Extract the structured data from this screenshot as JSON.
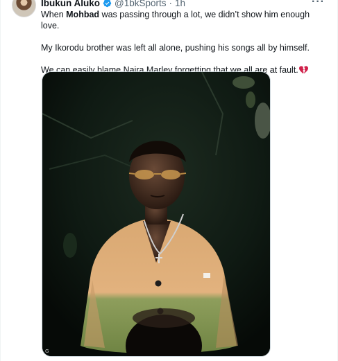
{
  "tweet": {
    "author_name": "Ibukun Aluko",
    "handle": "@1bkSports",
    "separator": "·",
    "time": "1h",
    "more_label": "···",
    "paragraph1": {
      "before": "When ",
      "mention": "Mohbad",
      "after": " was passing through a lot, we didn’t show him enough love."
    },
    "paragraph2": "My Ikorodu brother was left all alone, pushing his songs all by himself.",
    "paragraph3": "We can easily blame Naira Marley forgetting that we all are at fault.",
    "media": {
      "badge": "G"
    }
  },
  "colors": {
    "verified": "#1d9bf0",
    "broken_heart": "#d0204a",
    "secondary_text": "#536471"
  },
  "icons": {
    "verified": "verified-badge-icon",
    "broken_heart": "broken-heart-emoji-icon",
    "more": "more-icon"
  }
}
